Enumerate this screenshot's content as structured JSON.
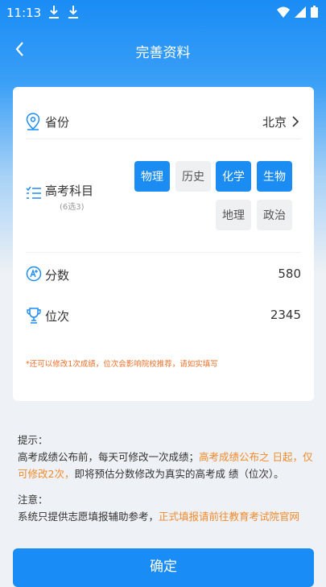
{
  "status": {
    "time": "11:13"
  },
  "nav": {
    "title": "完善资料"
  },
  "province": {
    "label": "省份",
    "value": "北京"
  },
  "subjects": {
    "label": "高考科目",
    "hint": "(6选3)",
    "items": [
      {
        "name": "物理",
        "selected": true
      },
      {
        "name": "历史",
        "selected": false
      },
      {
        "name": "化学",
        "selected": true
      },
      {
        "name": "生物",
        "selected": true
      },
      {
        "name": "地理",
        "selected": false
      },
      {
        "name": "政治",
        "selected": false
      }
    ]
  },
  "score": {
    "label": "分数",
    "value": "580"
  },
  "rank": {
    "label": "位次",
    "value": "2345"
  },
  "warning": "*还可以修改1次成绩，位次会影响院校推荐，请如实填写",
  "tips": {
    "heading": "提示：",
    "text1": "高考成绩公布前，每天可修改一次成绩；",
    "text2_orange": "高考成绩公布之 日起，仅可修改2次，",
    "text3": "即将预估分数修改为真实的高考成 绩（位次）。",
    "note_heading": "注意：",
    "note1": "系统只提供志愿填报辅助参考，",
    "note2_orange": "正式填报请前往教育考试院官网"
  },
  "confirm_label": "确定",
  "colors": {
    "accent": "#1a8cf5",
    "warning": "#f0702a",
    "chip_off": "#eff0f2"
  }
}
